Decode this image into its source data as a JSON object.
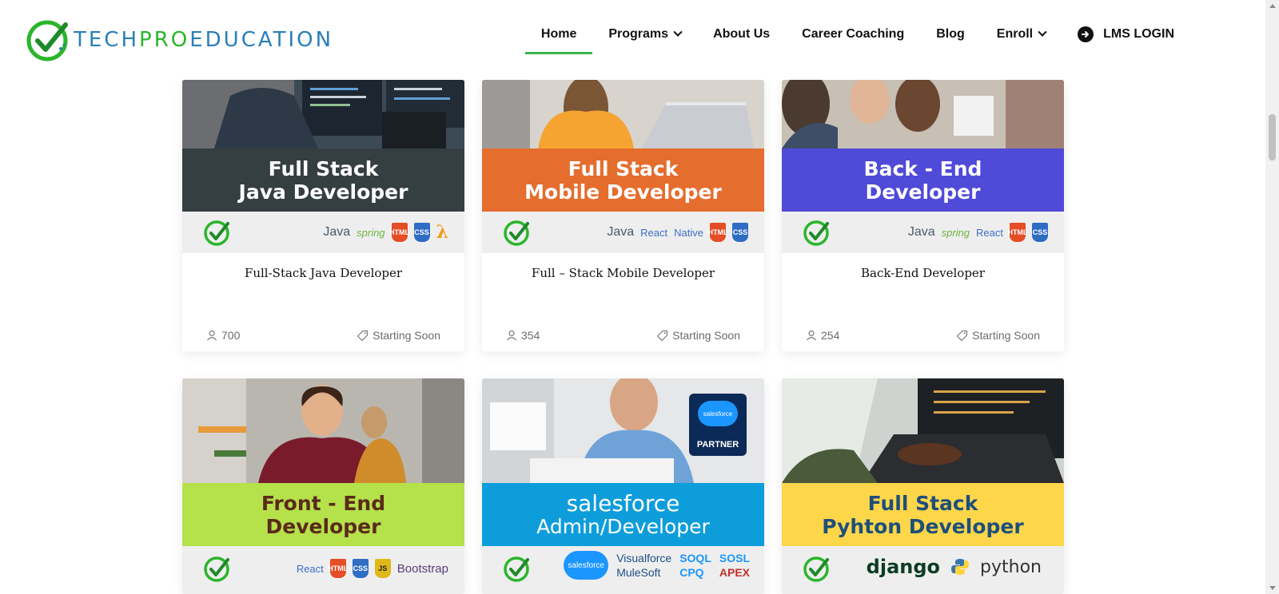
{
  "header": {
    "logo": {
      "part1": "TECH",
      "part2": "PRO",
      "part3": "EDUCATION"
    },
    "nav": [
      {
        "label": "Home",
        "active": true,
        "dropdown": false
      },
      {
        "label": "Programs",
        "active": false,
        "dropdown": true
      },
      {
        "label": "About Us",
        "active": false,
        "dropdown": false
      },
      {
        "label": "Career Coaching",
        "active": false,
        "dropdown": false
      },
      {
        "label": "Blog",
        "active": false,
        "dropdown": false
      },
      {
        "label": "Enroll",
        "active": false,
        "dropdown": true
      }
    ],
    "login": {
      "label": "LMS LOGIN",
      "icon": "arrow-circle-right-icon"
    }
  },
  "colors": {
    "accent_green": "#3bb54a",
    "logo_blue": "#2a7fb8",
    "logo_green": "#2bb52b"
  },
  "courses": [
    {
      "banner_line1": "Full Stack",
      "banner_line2": "Java Developer",
      "banner_color": "#353f42",
      "techs": [
        "Java",
        "spring",
        "HTML",
        "CSS",
        "λ"
      ],
      "title": "Full-Stack Java Developer",
      "students": "700",
      "status": "Starting Soon"
    },
    {
      "banner_line1": "Full Stack",
      "banner_line2": "Mobile Developer",
      "banner_color": "#e56d2e",
      "techs": [
        "Java",
        "React",
        "Native",
        "HTML",
        "CSS"
      ],
      "title": "Full – Stack Mobile Developer",
      "students": "354",
      "status": "Starting Soon"
    },
    {
      "banner_line1": "Back - End",
      "banner_line2": "Developer",
      "banner_color": "#4f4ad8",
      "techs": [
        "Java",
        "spring",
        "React",
        "HTML",
        "CSS"
      ],
      "title": "Back-End Developer",
      "students": "254",
      "status": "Starting Soon"
    },
    {
      "banner_line1": "Front - End",
      "banner_line2": "Developer",
      "banner_color": "#b5e14a",
      "techs": [
        "React",
        "HTML",
        "CSS",
        "JS",
        "Bootstrap"
      ]
    },
    {
      "banner_line1": "salesforce",
      "banner_line2": "Admin/Developer",
      "banner_color": "#0d9ddb",
      "partner": {
        "cloud": "salesforce",
        "label": "PARTNER"
      },
      "techs": [
        "salesforce",
        "Visualforce",
        "MuleSoft",
        "SOQL",
        "CPQ",
        "SOSL",
        "APEX"
      ]
    },
    {
      "banner_line1": "Full Stack",
      "banner_line2": "Pyhton Developer",
      "banner_color": "#fdd64a",
      "techs": [
        "django",
        "python"
      ]
    }
  ]
}
